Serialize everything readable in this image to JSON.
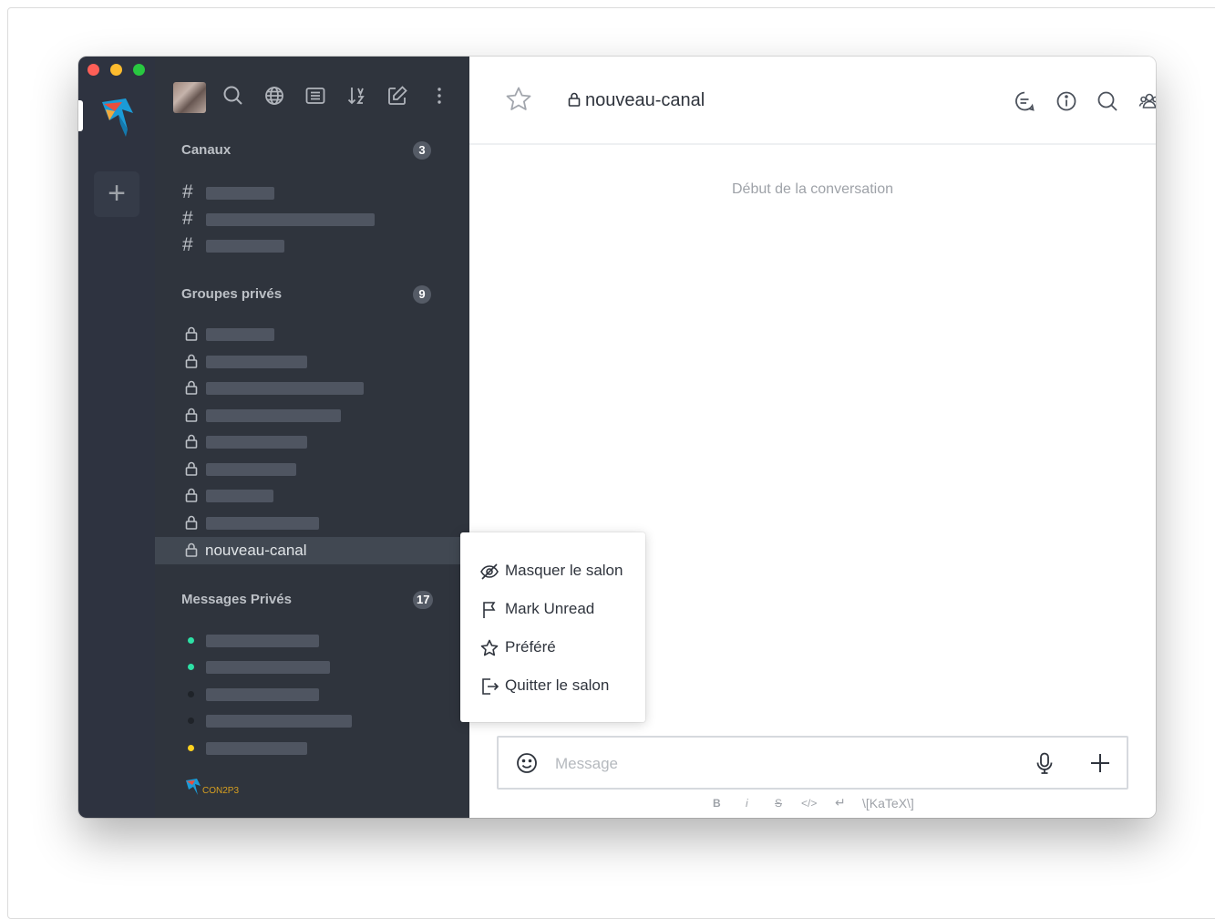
{
  "window": {
    "controls": [
      "close",
      "minimize",
      "zoom"
    ]
  },
  "servers": {
    "add_label": "+"
  },
  "sidebar": {
    "sections": [
      {
        "title": "Canaux",
        "count": "3"
      },
      {
        "title": "Groupes privés",
        "count": "9"
      },
      {
        "title": "Messages Privés",
        "count": "17"
      }
    ],
    "active_room": {
      "label": "nouveau-canal"
    },
    "brand_text": "CON2P3"
  },
  "header": {
    "room_title": "nouveau-canal"
  },
  "main": {
    "conversation_start": "Début de la conversation"
  },
  "composer": {
    "placeholder": "Message"
  },
  "format_toolbar": {
    "bold": "B",
    "italic": "i",
    "strike": "S",
    "code": "</>",
    "multiline": "↵",
    "katex": "\\[KaTeX\\]"
  },
  "context_menu": {
    "items": [
      {
        "label": "Masquer le salon",
        "icon": "eye-off-icon"
      },
      {
        "label": "Mark Unread",
        "icon": "flag-icon"
      },
      {
        "label": "Préféré",
        "icon": "star-icon"
      },
      {
        "label": "Quitter le salon",
        "icon": "leave-icon"
      }
    ]
  },
  "colors": {
    "sidebar_bg": "#2f343d",
    "rail_bg": "#2e3340",
    "online": "#2de0a5",
    "away": "#ffd21f",
    "offline": "#1f2329"
  }
}
